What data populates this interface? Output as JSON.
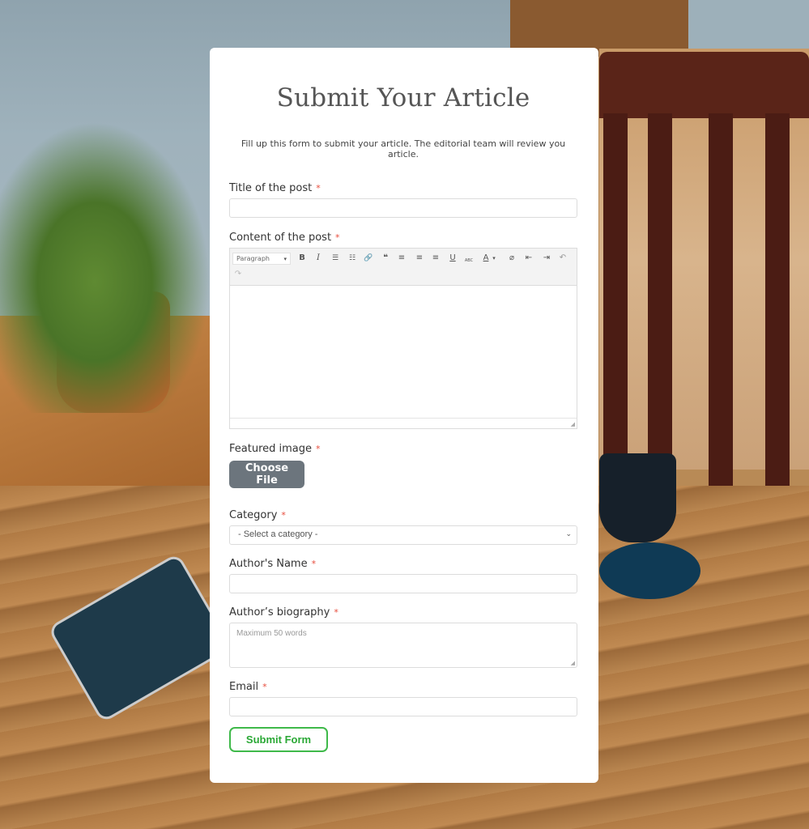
{
  "form": {
    "title": "Submit Your Article",
    "intro": "Fill up this form to submit your article. The editorial team will review you article.",
    "required_marker": "*",
    "fields": {
      "post_title": {
        "label": "Title of the post",
        "value": ""
      },
      "content": {
        "label": "Content of the post",
        "toolbar": {
          "format_select": "Paragraph",
          "icons": [
            "bold-icon",
            "italic-icon",
            "bullet-list-icon",
            "numbered-list-icon",
            "link-icon",
            "blockquote-icon",
            "align-left-icon",
            "align-center-icon",
            "align-right-icon",
            "underline-icon",
            "strikethrough-icon",
            "text-color-icon",
            "clear-format-icon",
            "outdent-icon",
            "indent-icon",
            "undo-icon",
            "redo-icon"
          ],
          "glyphs": {
            "bold": "B",
            "italic": "I",
            "bullets": "☰",
            "numbers": "☷",
            "link": "🔗",
            "quote": "❝",
            "align_left": "≡",
            "align_center": "≡",
            "align_right": "≡",
            "underline": "U",
            "strike": "ABC",
            "color": "A",
            "color_caret": "▾",
            "clear": "⌀",
            "outdent": "⇤",
            "indent": "⇥",
            "undo": "↶",
            "redo": "↷",
            "caret": "▾"
          }
        },
        "value": ""
      },
      "featured_image": {
        "label": "Featured image",
        "button": "Choose File"
      },
      "category": {
        "label": "Category",
        "selected": "- Select a category -",
        "chevron": "⌄"
      },
      "author_name": {
        "label": "Author's Name",
        "value": ""
      },
      "author_bio": {
        "label": "Author’s biography",
        "placeholder": "Maximum 50 words",
        "resize": "◢"
      },
      "email": {
        "label": "Email",
        "value": ""
      }
    },
    "submit_label": "Submit Form"
  },
  "colors": {
    "required": "#e74c3c",
    "file_button": "#6c757d",
    "submit_accent": "#3fb94a"
  }
}
